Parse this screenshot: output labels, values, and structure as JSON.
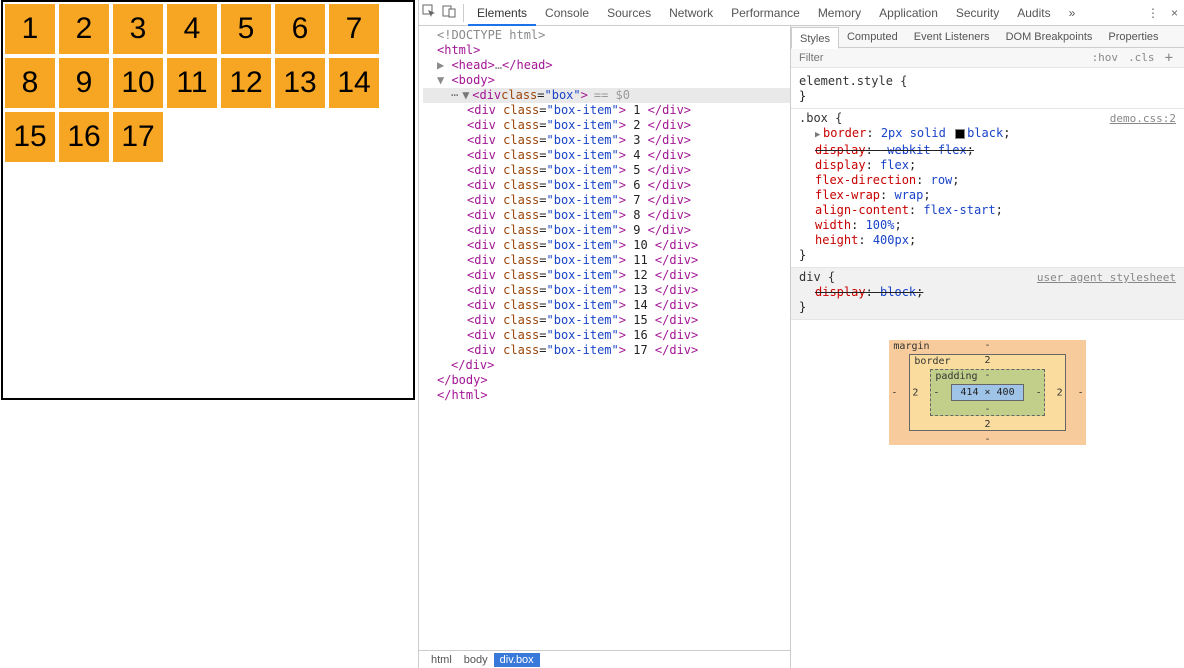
{
  "page": {
    "box_item_count": 17,
    "items": [
      "1",
      "2",
      "3",
      "4",
      "5",
      "6",
      "7",
      "8",
      "9",
      "10",
      "11",
      "12",
      "13",
      "14",
      "15",
      "16",
      "17"
    ]
  },
  "devtools": {
    "main_tabs": [
      "Elements",
      "Console",
      "Sources",
      "Network",
      "Performance",
      "Memory",
      "Application",
      "Security",
      "Audits"
    ],
    "main_active": "Elements",
    "overflow_glyph": "»",
    "menu_glyph": "⋮",
    "close_glyph": "×",
    "dom": {
      "doctype": "<!DOCTYPE html>",
      "html_open": "html",
      "head_collapsed": {
        "open": "head",
        "ellipsis": "…",
        "close": "head"
      },
      "body_open": "body",
      "selected": {
        "tag": "div",
        "attr_name": "class",
        "attr_val": "box",
        "suffix": "== $0"
      },
      "children": [
        {
          "tag": "div",
          "attr_name": "class",
          "attr_val": "box-item",
          "text": "1"
        },
        {
          "tag": "div",
          "attr_name": "class",
          "attr_val": "box-item",
          "text": "2"
        },
        {
          "tag": "div",
          "attr_name": "class",
          "attr_val": "box-item",
          "text": "3"
        },
        {
          "tag": "div",
          "attr_name": "class",
          "attr_val": "box-item",
          "text": "4"
        },
        {
          "tag": "div",
          "attr_name": "class",
          "attr_val": "box-item",
          "text": "5"
        },
        {
          "tag": "div",
          "attr_name": "class",
          "attr_val": "box-item",
          "text": "6"
        },
        {
          "tag": "div",
          "attr_name": "class",
          "attr_val": "box-item",
          "text": "7"
        },
        {
          "tag": "div",
          "attr_name": "class",
          "attr_val": "box-item",
          "text": "8"
        },
        {
          "tag": "div",
          "attr_name": "class",
          "attr_val": "box-item",
          "text": "9"
        },
        {
          "tag": "div",
          "attr_name": "class",
          "attr_val": "box-item",
          "text": "10"
        },
        {
          "tag": "div",
          "attr_name": "class",
          "attr_val": "box-item",
          "text": "11"
        },
        {
          "tag": "div",
          "attr_name": "class",
          "attr_val": "box-item",
          "text": "12"
        },
        {
          "tag": "div",
          "attr_name": "class",
          "attr_val": "box-item",
          "text": "13"
        },
        {
          "tag": "div",
          "attr_name": "class",
          "attr_val": "box-item",
          "text": "14"
        },
        {
          "tag": "div",
          "attr_name": "class",
          "attr_val": "box-item",
          "text": "15"
        },
        {
          "tag": "div",
          "attr_name": "class",
          "attr_val": "box-item",
          "text": "16"
        },
        {
          "tag": "div",
          "attr_name": "class",
          "attr_val": "box-item",
          "text": "17"
        }
      ],
      "close_div": "div",
      "close_body": "body",
      "close_html": "html"
    },
    "breadcrumb": [
      "html",
      "body",
      "div.box"
    ],
    "breadcrumb_selected": "div.box",
    "styles": {
      "sub_tabs": [
        "Styles",
        "Computed",
        "Event Listeners",
        "DOM Breakpoints",
        "Properties"
      ],
      "sub_active": "Styles",
      "filter_placeholder": "Filter",
      "toggles": [
        ":hov",
        ".cls"
      ],
      "plus": "+",
      "rules": [
        {
          "selector": "element.style",
          "origin": "",
          "props": []
        },
        {
          "selector": ".box",
          "origin": "demo.css:2",
          "props": [
            {
              "name": "border",
              "value": "2px solid ■black",
              "expand": true,
              "swatch": true
            },
            {
              "name": "display",
              "value": "-webkit-flex",
              "strike": true
            },
            {
              "name": "display",
              "value": "flex"
            },
            {
              "name": "flex-direction",
              "value": "row"
            },
            {
              "name": "flex-wrap",
              "value": "wrap"
            },
            {
              "name": "align-content",
              "value": "flex-start"
            },
            {
              "name": "width",
              "value": "100%"
            },
            {
              "name": "height",
              "value": "400px"
            }
          ]
        },
        {
          "selector": "div",
          "origin": "user agent stylesheet",
          "ua": true,
          "props": [
            {
              "name": "display",
              "value": "block",
              "strike": true
            }
          ]
        }
      ],
      "box_model": {
        "margin": {
          "label": "margin",
          "t": "-",
          "r": "-",
          "b": "-",
          "l": "-"
        },
        "border": {
          "label": "border",
          "t": "2",
          "r": "2",
          "b": "2",
          "l": "2"
        },
        "padding": {
          "label": "padding",
          "t": "-",
          "r": "-",
          "b": "-",
          "l": "-"
        },
        "content": "414 × 400"
      }
    }
  },
  "watermark": ""
}
